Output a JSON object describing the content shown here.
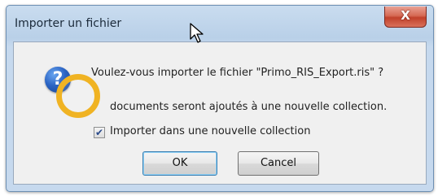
{
  "window": {
    "title": "Importer un fichier",
    "close_label": "X"
  },
  "dialog": {
    "icon": "question-icon",
    "question": "Voulez-vous importer le fichier \"Primo_RIS_Export.ris\" ?",
    "info": "documents seront ajoutés à une nouvelle collection.",
    "checkbox": {
      "label": "Importer dans une nouvelle collection",
      "checked": true
    },
    "buttons": {
      "ok": "OK",
      "cancel": "Cancel"
    }
  },
  "annotation": {
    "highlight_color": "#f0b323"
  }
}
